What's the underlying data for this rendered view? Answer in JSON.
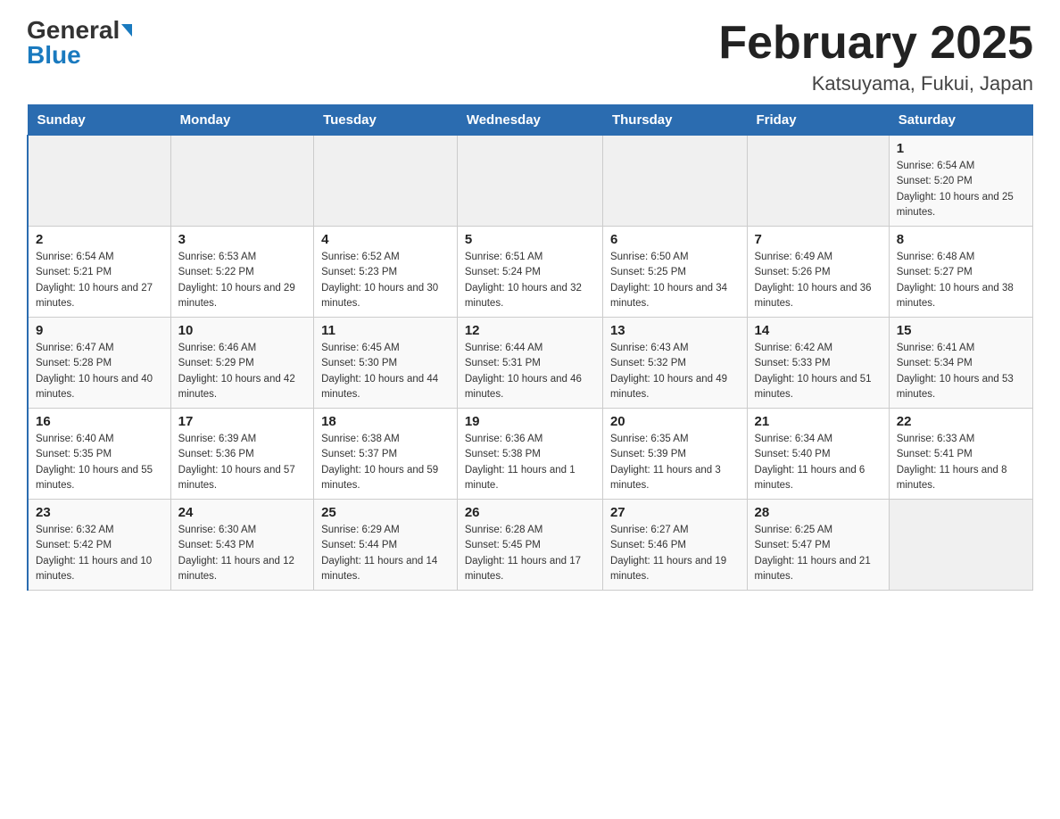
{
  "header": {
    "logo_general": "General",
    "logo_blue": "Blue",
    "title": "February 2025",
    "subtitle": "Katsuyama, Fukui, Japan"
  },
  "days_of_week": [
    "Sunday",
    "Monday",
    "Tuesday",
    "Wednesday",
    "Thursday",
    "Friday",
    "Saturday"
  ],
  "weeks": [
    [
      {
        "day": "",
        "sunrise": "",
        "sunset": "",
        "daylight": ""
      },
      {
        "day": "",
        "sunrise": "",
        "sunset": "",
        "daylight": ""
      },
      {
        "day": "",
        "sunrise": "",
        "sunset": "",
        "daylight": ""
      },
      {
        "day": "",
        "sunrise": "",
        "sunset": "",
        "daylight": ""
      },
      {
        "day": "",
        "sunrise": "",
        "sunset": "",
        "daylight": ""
      },
      {
        "day": "",
        "sunrise": "",
        "sunset": "",
        "daylight": ""
      },
      {
        "day": "1",
        "sunrise": "Sunrise: 6:54 AM",
        "sunset": "Sunset: 5:20 PM",
        "daylight": "Daylight: 10 hours and 25 minutes."
      }
    ],
    [
      {
        "day": "2",
        "sunrise": "Sunrise: 6:54 AM",
        "sunset": "Sunset: 5:21 PM",
        "daylight": "Daylight: 10 hours and 27 minutes."
      },
      {
        "day": "3",
        "sunrise": "Sunrise: 6:53 AM",
        "sunset": "Sunset: 5:22 PM",
        "daylight": "Daylight: 10 hours and 29 minutes."
      },
      {
        "day": "4",
        "sunrise": "Sunrise: 6:52 AM",
        "sunset": "Sunset: 5:23 PM",
        "daylight": "Daylight: 10 hours and 30 minutes."
      },
      {
        "day": "5",
        "sunrise": "Sunrise: 6:51 AM",
        "sunset": "Sunset: 5:24 PM",
        "daylight": "Daylight: 10 hours and 32 minutes."
      },
      {
        "day": "6",
        "sunrise": "Sunrise: 6:50 AM",
        "sunset": "Sunset: 5:25 PM",
        "daylight": "Daylight: 10 hours and 34 minutes."
      },
      {
        "day": "7",
        "sunrise": "Sunrise: 6:49 AM",
        "sunset": "Sunset: 5:26 PM",
        "daylight": "Daylight: 10 hours and 36 minutes."
      },
      {
        "day": "8",
        "sunrise": "Sunrise: 6:48 AM",
        "sunset": "Sunset: 5:27 PM",
        "daylight": "Daylight: 10 hours and 38 minutes."
      }
    ],
    [
      {
        "day": "9",
        "sunrise": "Sunrise: 6:47 AM",
        "sunset": "Sunset: 5:28 PM",
        "daylight": "Daylight: 10 hours and 40 minutes."
      },
      {
        "day": "10",
        "sunrise": "Sunrise: 6:46 AM",
        "sunset": "Sunset: 5:29 PM",
        "daylight": "Daylight: 10 hours and 42 minutes."
      },
      {
        "day": "11",
        "sunrise": "Sunrise: 6:45 AM",
        "sunset": "Sunset: 5:30 PM",
        "daylight": "Daylight: 10 hours and 44 minutes."
      },
      {
        "day": "12",
        "sunrise": "Sunrise: 6:44 AM",
        "sunset": "Sunset: 5:31 PM",
        "daylight": "Daylight: 10 hours and 46 minutes."
      },
      {
        "day": "13",
        "sunrise": "Sunrise: 6:43 AM",
        "sunset": "Sunset: 5:32 PM",
        "daylight": "Daylight: 10 hours and 49 minutes."
      },
      {
        "day": "14",
        "sunrise": "Sunrise: 6:42 AM",
        "sunset": "Sunset: 5:33 PM",
        "daylight": "Daylight: 10 hours and 51 minutes."
      },
      {
        "day": "15",
        "sunrise": "Sunrise: 6:41 AM",
        "sunset": "Sunset: 5:34 PM",
        "daylight": "Daylight: 10 hours and 53 minutes."
      }
    ],
    [
      {
        "day": "16",
        "sunrise": "Sunrise: 6:40 AM",
        "sunset": "Sunset: 5:35 PM",
        "daylight": "Daylight: 10 hours and 55 minutes."
      },
      {
        "day": "17",
        "sunrise": "Sunrise: 6:39 AM",
        "sunset": "Sunset: 5:36 PM",
        "daylight": "Daylight: 10 hours and 57 minutes."
      },
      {
        "day": "18",
        "sunrise": "Sunrise: 6:38 AM",
        "sunset": "Sunset: 5:37 PM",
        "daylight": "Daylight: 10 hours and 59 minutes."
      },
      {
        "day": "19",
        "sunrise": "Sunrise: 6:36 AM",
        "sunset": "Sunset: 5:38 PM",
        "daylight": "Daylight: 11 hours and 1 minute."
      },
      {
        "day": "20",
        "sunrise": "Sunrise: 6:35 AM",
        "sunset": "Sunset: 5:39 PM",
        "daylight": "Daylight: 11 hours and 3 minutes."
      },
      {
        "day": "21",
        "sunrise": "Sunrise: 6:34 AM",
        "sunset": "Sunset: 5:40 PM",
        "daylight": "Daylight: 11 hours and 6 minutes."
      },
      {
        "day": "22",
        "sunrise": "Sunrise: 6:33 AM",
        "sunset": "Sunset: 5:41 PM",
        "daylight": "Daylight: 11 hours and 8 minutes."
      }
    ],
    [
      {
        "day": "23",
        "sunrise": "Sunrise: 6:32 AM",
        "sunset": "Sunset: 5:42 PM",
        "daylight": "Daylight: 11 hours and 10 minutes."
      },
      {
        "day": "24",
        "sunrise": "Sunrise: 6:30 AM",
        "sunset": "Sunset: 5:43 PM",
        "daylight": "Daylight: 11 hours and 12 minutes."
      },
      {
        "day": "25",
        "sunrise": "Sunrise: 6:29 AM",
        "sunset": "Sunset: 5:44 PM",
        "daylight": "Daylight: 11 hours and 14 minutes."
      },
      {
        "day": "26",
        "sunrise": "Sunrise: 6:28 AM",
        "sunset": "Sunset: 5:45 PM",
        "daylight": "Daylight: 11 hours and 17 minutes."
      },
      {
        "day": "27",
        "sunrise": "Sunrise: 6:27 AM",
        "sunset": "Sunset: 5:46 PM",
        "daylight": "Daylight: 11 hours and 19 minutes."
      },
      {
        "day": "28",
        "sunrise": "Sunrise: 6:25 AM",
        "sunset": "Sunset: 5:47 PM",
        "daylight": "Daylight: 11 hours and 21 minutes."
      },
      {
        "day": "",
        "sunrise": "",
        "sunset": "",
        "daylight": ""
      }
    ]
  ]
}
